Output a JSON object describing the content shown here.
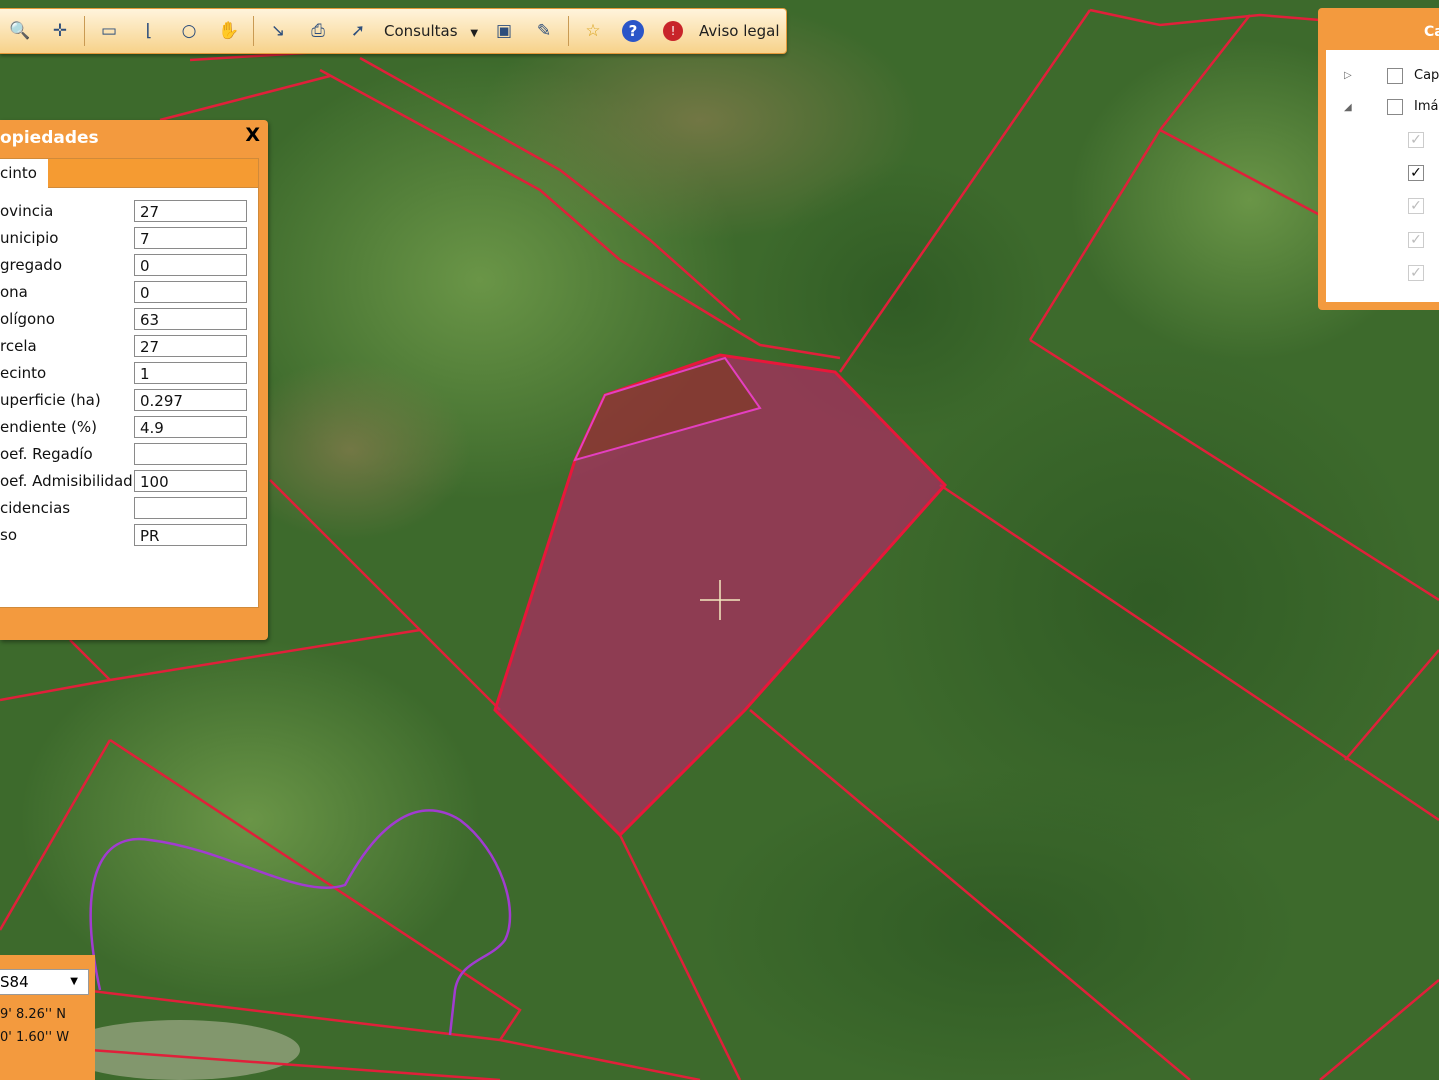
{
  "toolbar": {
    "icons": [
      "zoom-icon",
      "pan-crosshair-icon",
      "measure-distance-icon",
      "measure-area-icon",
      "circle-icon",
      "hand-icon",
      "xy-coordinates-icon",
      "print-icon",
      "identify-icon",
      "book-icon",
      "edit-icon",
      "favorite-icon",
      "help-icon",
      "legal-icon"
    ],
    "consultas_label": "Consultas",
    "aviso_label": "Aviso legal"
  },
  "properties": {
    "title": "opiedades",
    "close_label": "X",
    "tab_label": "cinto",
    "rows": [
      {
        "label": "ovincia",
        "value": "27"
      },
      {
        "label": "unicipio",
        "value": "7"
      },
      {
        "label": "gregado",
        "value": "0"
      },
      {
        "label": "ona",
        "value": "0"
      },
      {
        "label": "olígono",
        "value": "63"
      },
      {
        "label": "rcela",
        "value": "27"
      },
      {
        "label": "ecinto",
        "value": "1"
      },
      {
        "label": "uperficie (ha)",
        "value": "0.297"
      },
      {
        "label": "endiente (%)",
        "value": "4.9"
      },
      {
        "label": "oef. Regadío",
        "value": ""
      },
      {
        "label": "oef. Admisibilidad",
        "value": "100"
      },
      {
        "label": "cidencias",
        "value": ""
      },
      {
        "label": "so",
        "value": "PR"
      }
    ]
  },
  "layers": {
    "title": "Ca",
    "items": [
      {
        "label": "Capa",
        "checked": false
      },
      {
        "label": "Imá",
        "checked": false
      }
    ],
    "sub_checks": [
      true,
      true,
      true,
      true,
      true
    ]
  },
  "coords": {
    "system": "S84",
    "lat": "9' 8.26'' N",
    "lon": "0' 1.60'' W"
  },
  "colors": {
    "panel_orange": "#f39a3e",
    "parcel_line": "#e0203a",
    "selected_fill": "#c0206a",
    "purple_boundary": "#a13cd0"
  }
}
